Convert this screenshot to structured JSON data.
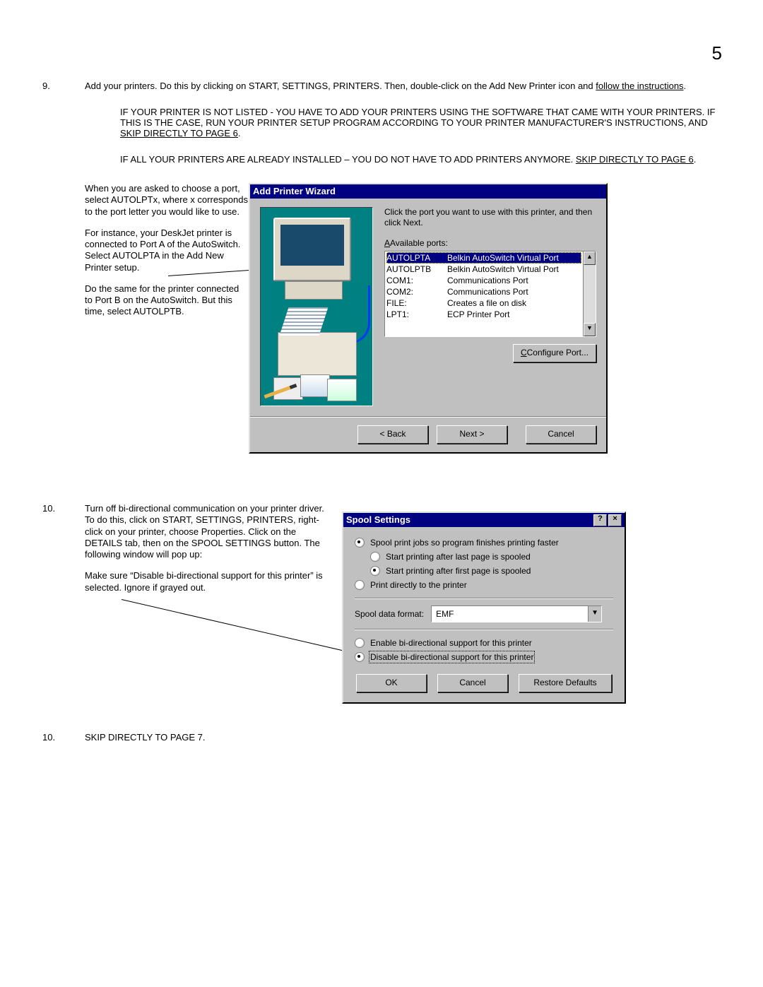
{
  "page_number": "5",
  "step9": {
    "num": "9.",
    "main_a": "Add your printers.  Do this by clicking on START, SETTINGS, PRINTERS.  Then, double-click on the Add New Printer icon and ",
    "main_b": "follow the instructions",
    "sub1_a": "IF YOUR PRINTER IS NOT LISTED -  YOU HAVE TO ADD YOUR PRINTERS USING THE SOFTWARE THAT CAME WITH YOUR PRINTERS.  IF THIS IS THE CASE, RUN YOUR PRINTER SETUP PROGRAM ACCORDING TO YOUR PRINTER MANUFACTURER'S INSTRUCTIONS, AND ",
    "sub1_b": "SKIP DIRECTLY TO PAGE 6",
    "sub2_a": "IF ALL YOUR PRINTERS ARE ALREADY INSTALLED – YOU DO NOT HAVE TO ADD PRINTERS ANYMORE.  ",
    "sub2_b": "SKIP DIRECTLY TO PAGE 6",
    "left_p1": "When you are asked to choose a port, select AUTOLPTx, where x corresponds to the port letter you would like to use.",
    "left_p2": "For instance, your DeskJet printer is connected to Port A of the AutoSwitch.  Select AUTOLPTA in the Add New Printer setup.",
    "left_p3": "Do the same for the printer connected to Port B on the AutoSwitch.  But this time, select AUTOLPTB."
  },
  "wizard": {
    "title": "Add Printer Wizard",
    "instruction": "Click the port you want to use with this printer, and then click Next.",
    "list_label": "Available ports:",
    "ports": [
      {
        "code": "AUTOLPTA",
        "desc": "Belkin AutoSwitch Virtual Port",
        "selected": true
      },
      {
        "code": "AUTOLPTB",
        "desc": "Belkin AutoSwitch Virtual Port",
        "selected": false
      },
      {
        "code": "COM1:",
        "desc": "Communications Port",
        "selected": false
      },
      {
        "code": "COM2:",
        "desc": "Communications Port",
        "selected": false
      },
      {
        "code": "FILE:",
        "desc": "Creates a file on disk",
        "selected": false
      },
      {
        "code": "LPT1:",
        "desc": "ECP Printer Port",
        "selected": false
      }
    ],
    "configure": "Configure Port...",
    "back": "< Back",
    "next": "Next >",
    "cancel": "Cancel"
  },
  "step10": {
    "num": "10.",
    "p1": "Turn off bi-directional communication on your printer driver.   To do this, click on START, SETTINGS, PRINTERS, right-click on your printer, choose Properties.  Click on the DETAILS tab, then on the SPOOL SETTINGS button.  The following window will pop up:",
    "p2": "Make sure “Disable bi-directional support for this printer” is selected.  Ignore if grayed out."
  },
  "spool": {
    "title": "Spool Settings",
    "opt_spool": "Spool print jobs so program finishes printing faster",
    "opt_last": "Start printing after last page is spooled",
    "opt_first": "Start printing after first page is spooled",
    "opt_direct": "Print directly to the printer",
    "format_label": "Spool data format:",
    "format_value": "EMF",
    "opt_enable": "Enable bi-directional support for this printer",
    "opt_disable": "Disable bi-directional support for this printer",
    "ok": "OK",
    "cancel": "Cancel",
    "restore": "Restore Defaults"
  },
  "step10b": {
    "num": "10.",
    "text": "SKIP DIRECTLY TO PAGE 7."
  }
}
